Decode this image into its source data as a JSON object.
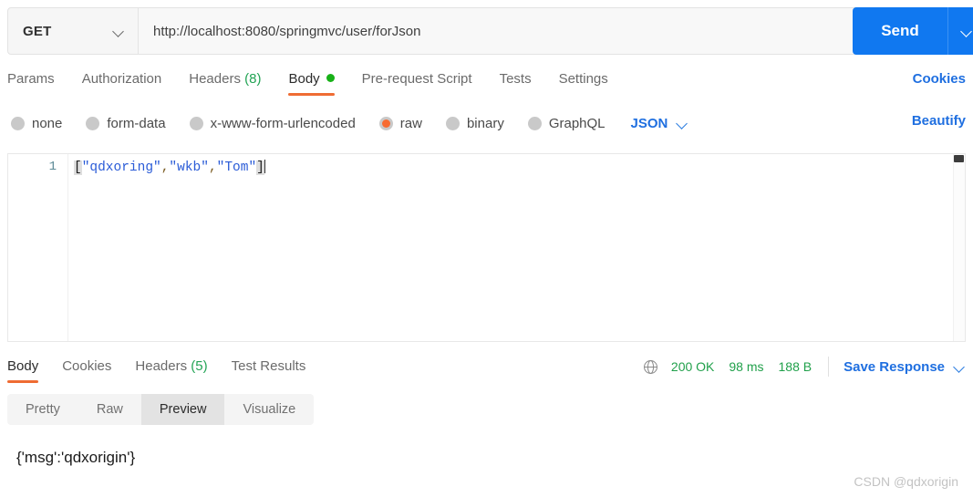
{
  "request": {
    "method": "GET",
    "url": "http://localhost:8080/springmvc/user/forJson",
    "send_label": "Send",
    "tabs": [
      {
        "label": "Params",
        "active": false
      },
      {
        "label": "Authorization",
        "active": false
      },
      {
        "label": "Headers",
        "count": "(8)",
        "active": false
      },
      {
        "label": "Body",
        "active": true,
        "dot": true
      },
      {
        "label": "Pre-request Script",
        "active": false
      },
      {
        "label": "Tests",
        "active": false
      },
      {
        "label": "Settings",
        "active": false
      }
    ],
    "cookies_link": "Cookies",
    "beautify_link": "Beautify",
    "body_types": [
      {
        "label": "none",
        "selected": false
      },
      {
        "label": "form-data",
        "selected": false
      },
      {
        "label": "x-www-form-urlencoded",
        "selected": false
      },
      {
        "label": "raw",
        "selected": true
      },
      {
        "label": "binary",
        "selected": false
      },
      {
        "label": "GraphQL",
        "selected": false
      }
    ],
    "raw_format": "JSON",
    "editor": {
      "line_number": "1",
      "open_bracket": "[",
      "close_bracket": "]",
      "items": [
        "\"qdxoring\"",
        "\"wkb\"",
        "\"Tom\""
      ],
      "separator": ",",
      "full_text": "[\"qdxoring\",\"wkb\",\"Tom\"]"
    }
  },
  "response": {
    "tabs": [
      {
        "label": "Body",
        "active": true
      },
      {
        "label": "Cookies",
        "active": false
      },
      {
        "label": "Headers",
        "count": "(5)",
        "active": false
      },
      {
        "label": "Test Results",
        "active": false
      }
    ],
    "status_code": "200 OK",
    "time": "98 ms",
    "size": "188 B",
    "save_response_label": "Save Response",
    "view_modes": [
      {
        "label": "Pretty",
        "active": false
      },
      {
        "label": "Raw",
        "active": false
      },
      {
        "label": "Preview",
        "active": true
      },
      {
        "label": "Visualize",
        "active": false
      }
    ],
    "preview_text": "{'msg':'qdxorigin'}"
  },
  "watermark": "CSDN @qdxorigin",
  "colors": {
    "accent_blue": "#1078f0",
    "link_blue": "#1f6fe0",
    "active_orange": "#ef6c33",
    "radio_orange": "#f76b32",
    "status_green": "#21a04b",
    "dot_green": "#18b118",
    "count_green": "#23a455"
  }
}
